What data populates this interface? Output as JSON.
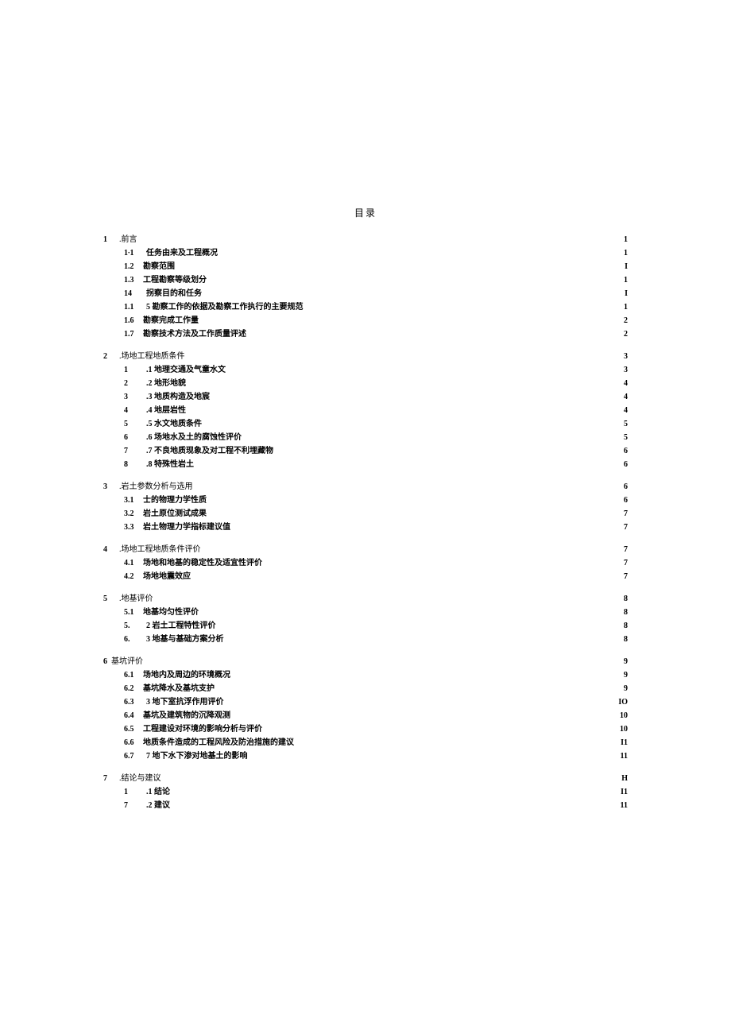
{
  "title": "目录",
  "toc": [
    {
      "type": "lvl1",
      "num": "1",
      "label": ".前言",
      "page": "1"
    },
    {
      "type": "sub",
      "num": "1∙1",
      "label": "任务由来及工程概况",
      "page": "1",
      "bold": true
    },
    {
      "type": "sub2",
      "num": "1.2",
      "label": "勘察范围",
      "page": "I",
      "bold": true
    },
    {
      "type": "sub2",
      "num": "1.3",
      "label": "工程勘察等级划分",
      "page": "1",
      "bold": true
    },
    {
      "type": "sub",
      "num": "14",
      "label": "拐察目的和任务",
      "page": "I",
      "bold": true
    },
    {
      "type": "sub",
      "num": "1.1",
      "label": "5 勘察工作的依据及勘察工作执行的主要规范",
      "page": "1",
      "bold": true
    },
    {
      "type": "sub2",
      "num": "1.6",
      "label": "勘察完成工作量",
      "page": "2",
      "bold": true
    },
    {
      "type": "sub2",
      "num": "1.7",
      "label": "勘察技术方法及工作质量评述",
      "page": "2",
      "bold": true
    },
    {
      "type": "lvl1",
      "num": "2",
      "label": ".场地工程地质条件",
      "page": "3"
    },
    {
      "type": "sub",
      "num": "1",
      "label": ".1 地理交通及气童水文",
      "page": "3",
      "bold": true
    },
    {
      "type": "sub",
      "num": "2",
      "label": ".2 地形地貌",
      "page": "4",
      "bold": true
    },
    {
      "type": "sub",
      "num": "3",
      "label": ".3 地质构造及地宸",
      "page": "4",
      "bold": true
    },
    {
      "type": "sub",
      "num": "4",
      "label": ".4 地层岩性",
      "page": "4",
      "bold": true
    },
    {
      "type": "sub",
      "num": "5",
      "label": ".5 水文地质条件",
      "page": "5",
      "bold": true
    },
    {
      "type": "sub",
      "num": "6",
      "label": ".6 场地水及土的腐蚀性评价",
      "page": "5",
      "bold": true
    },
    {
      "type": "sub",
      "num": "7",
      "label": ".7 不良地质现象及对工程不利埋藏物",
      "page": "6",
      "bold": true
    },
    {
      "type": "sub",
      "num": "8",
      "label": ".8 特殊性岩土",
      "page": "6",
      "bold": true
    },
    {
      "type": "lvl1",
      "num": "3",
      "label": ".岩土参数分析与选用",
      "page": "6"
    },
    {
      "type": "sub2",
      "num": "3.1",
      "label": "士的物理力学性质",
      "page": "6",
      "bold": true
    },
    {
      "type": "sub2",
      "num": "3.2",
      "label": "岩土原位测试成果",
      "page": "7",
      "bold": true
    },
    {
      "type": "sub2",
      "num": "3.3",
      "label": "岩土物理力学指标建议值",
      "page": "7",
      "bold": true
    },
    {
      "type": "lvl1",
      "num": "4",
      "label": ".场地工程地质条件评价",
      "page": "7"
    },
    {
      "type": "sub2",
      "num": "4.1",
      "label": "场地和地基的稳定性及适宜性评价",
      "page": "7",
      "bold": true
    },
    {
      "type": "sub2",
      "num": "4.2",
      "label": "场地地震效应",
      "page": "7",
      "bold": true
    },
    {
      "type": "lvl1",
      "num": "5",
      "label": ".地基评价",
      "page": "8"
    },
    {
      "type": "sub2",
      "num": "5.1",
      "label": "地基均匀性评价",
      "page": "8",
      "bold": true
    },
    {
      "type": "sub",
      "num": "5.",
      "label": "2 岩土工程特性评价",
      "page": "8",
      "bold": true
    },
    {
      "type": "sub",
      "num": "6.",
      "label": "3 地基与基础方案分析",
      "page": "8",
      "bold": true
    },
    {
      "type": "lvl1-noindent",
      "num": "6",
      "label": "基坑评价",
      "page": "9"
    },
    {
      "type": "sub2",
      "num": "6.1",
      "label": "场地内及周边的环境概况",
      "page": "9",
      "bold": true
    },
    {
      "type": "sub2",
      "num": "6.2",
      "label": "基坑降水及基坑支护",
      "page": "9",
      "bold": true
    },
    {
      "type": "sub",
      "num": "6.3",
      "label": "3 地下室抗浮作用评价",
      "page": "IO",
      "bold": true
    },
    {
      "type": "sub2",
      "num": "6.4",
      "label": "基坑及建筑物的沉降观测",
      "page": "10",
      "bold": true
    },
    {
      "type": "sub2",
      "num": "6.5",
      "label": "工程建设对环境的影响分析与评价",
      "page": "10",
      "bold": true
    },
    {
      "type": "sub2",
      "num": "6.6",
      "label": "地质条件造成的工程风险及防治措施的建议",
      "page": "I1",
      "bold": true
    },
    {
      "type": "sub",
      "num": "6.7",
      "label": "7 地下水下渗对地基土的影响",
      "page": "11",
      "bold": true
    },
    {
      "type": "lvl1",
      "num": "7",
      "label": ".结论与建议",
      "page": "H"
    },
    {
      "type": "sub",
      "num": "1",
      "label": ".1 结论",
      "page": "I1",
      "bold": true
    },
    {
      "type": "sub",
      "num": "7",
      "label": ".2 建议",
      "page": "11",
      "bold": true
    }
  ]
}
